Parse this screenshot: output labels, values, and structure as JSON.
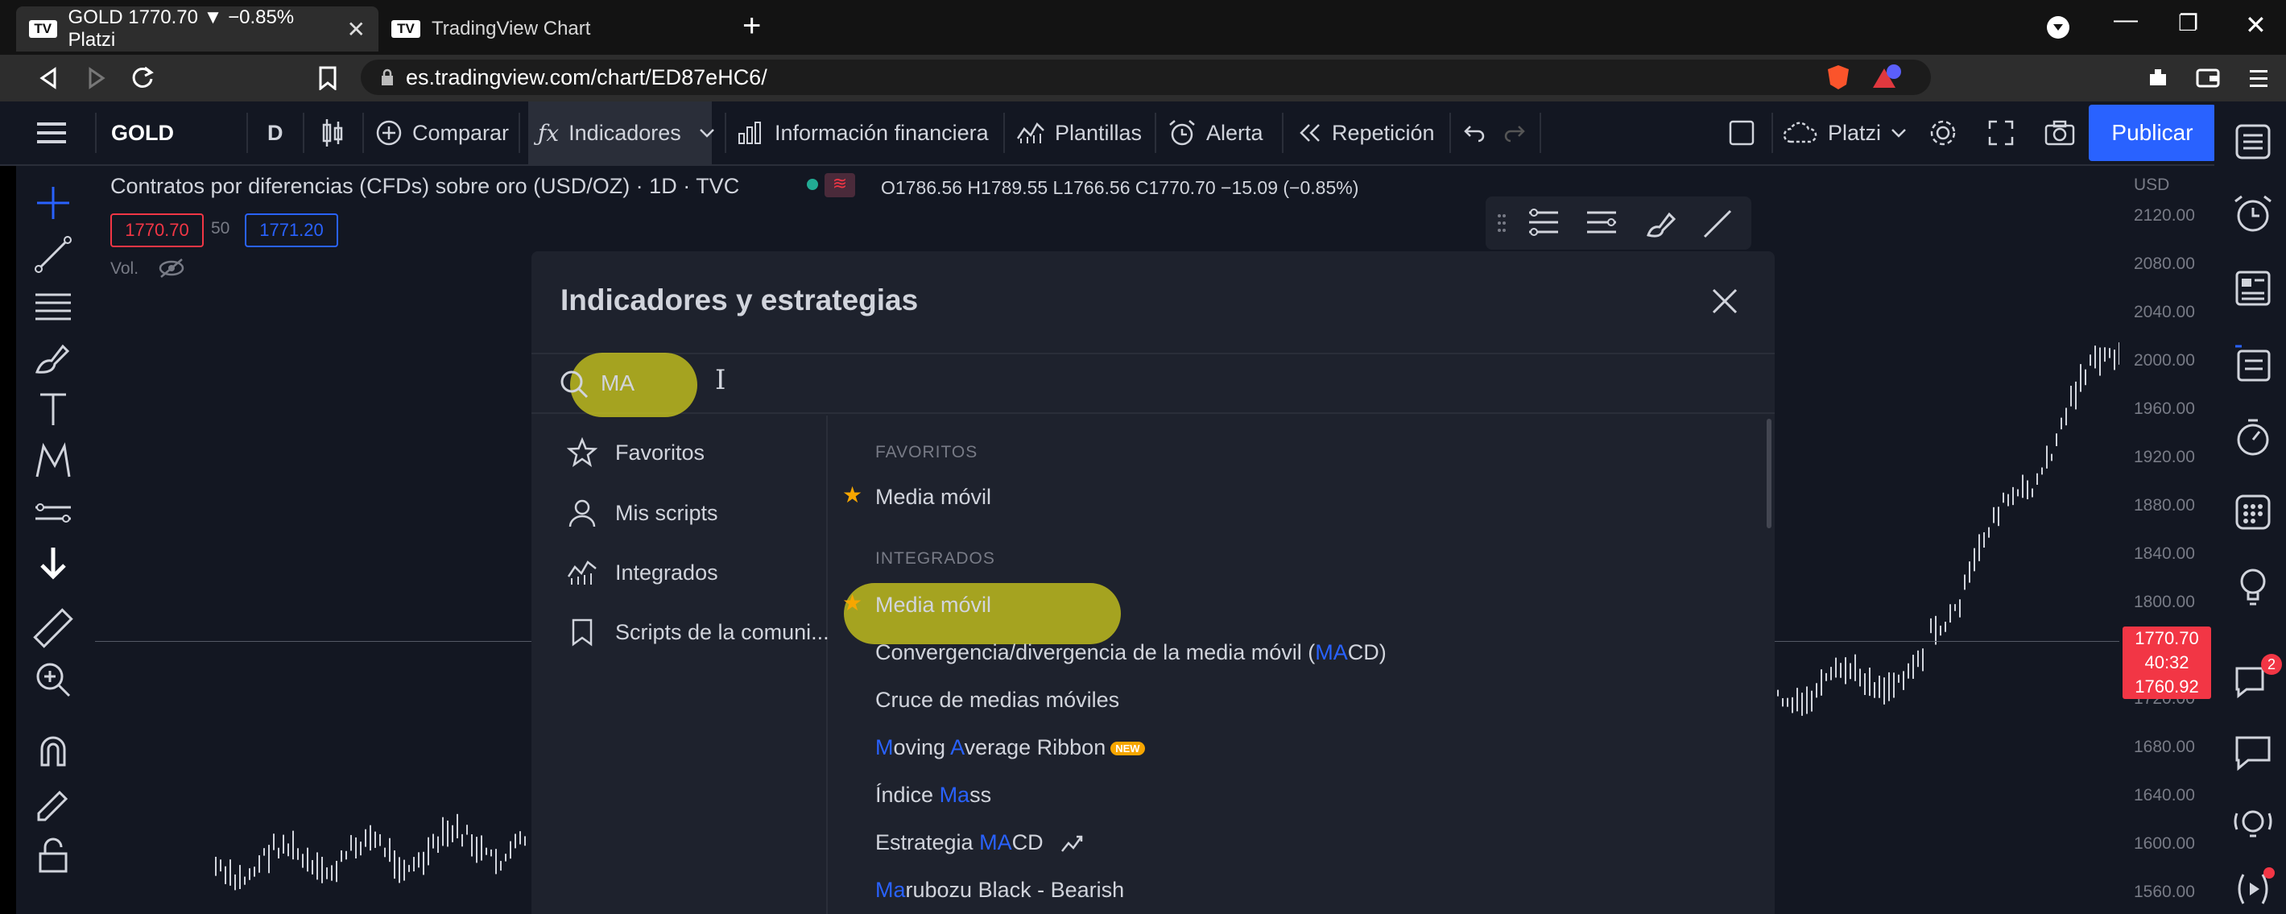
{
  "browser": {
    "tabs": [
      {
        "title": "GOLD 1770.70 ▼ −0.85% Platzi",
        "close": "✕"
      },
      {
        "title": "TradingView Chart"
      }
    ],
    "new_tab": "+",
    "url": "es.tradingview.com/chart/ED87eHC6/",
    "window_controls": {
      "minimize": "—",
      "maximize": "❐",
      "close": "✕"
    }
  },
  "toolbar": {
    "symbol": "GOLD",
    "interval": "D",
    "compare": "Comparar",
    "indicators": "Indicadores",
    "financials": "Información financiera",
    "templates": "Plantillas",
    "alert": "Alerta",
    "replay": "Repetición",
    "layout_name": "Platzi",
    "publish": "Publicar"
  },
  "legend": {
    "title": "Contratos por diferencias (CFDs) sobre oro (USD/OZ) · 1D · TVC",
    "ohlc": "O1786.56  H1789.55  L1766.56  C1770.70  −15.09 (−0.85%)",
    "bid": "1770.70",
    "spread": "50",
    "ask": "1771.20",
    "vol": "Vol."
  },
  "price_axis": {
    "currency": "USD",
    "labels": [
      "2120.00",
      "2080.00",
      "2040.00",
      "2000.00",
      "1960.00",
      "1920.00",
      "1880.00",
      "1840.00",
      "1800.00",
      "1720.00",
      "1680.00",
      "1640.00",
      "1600.00",
      "1560.00"
    ],
    "current": {
      "price": "1770.70",
      "countdown": "40:32",
      "low": "1760.92"
    }
  },
  "dialog": {
    "title": "Indicadores y estrategias",
    "search_value": "MA",
    "categories": [
      "Favoritos",
      "Mis scripts",
      "Integrados",
      "Scripts de la comuni..."
    ],
    "favorites_header": "FAVORITOS",
    "favorites": [
      "Media móvil"
    ],
    "builtin_header": "INTEGRADOS",
    "builtin": [
      {
        "pre": "",
        "hl": "",
        "post": "Media móvil"
      },
      {
        "pre": "Convergencia/divergencia de la media móvil (",
        "hl": "MA",
        "post": "CD)"
      },
      {
        "pre": "",
        "hl": "",
        "post": "Cruce de medias móviles"
      },
      {
        "pre": "",
        "hl": "M",
        "post": "oving ",
        "hl2": "A",
        "post2": "verage Ribbon",
        "badge": "NEW"
      },
      {
        "pre": "Índice ",
        "hl": "Ma",
        "post": "ss"
      },
      {
        "pre": "Estrategia ",
        "hl": "MA",
        "post": "CD"
      },
      {
        "pre": "",
        "hl": "Ma",
        "post": "rubozu Black - Bearish"
      }
    ]
  },
  "notifications_badge": "2",
  "colors": {
    "accent": "#2962ff",
    "bg": "#131722",
    "panel": "#1e222d",
    "star": "#f7a600",
    "bear": "#f23645",
    "marker": "#d8d61c"
  },
  "icons": [
    "menu-icon",
    "crosshair-icon",
    "trendline-icon",
    "fib-icon",
    "brush-icon",
    "text-icon",
    "pattern-icon",
    "measure-icon",
    "zoom-icon",
    "magnet-icon",
    "lock-icon",
    "watchlist-icon",
    "alarm-icon",
    "news-icon",
    "calendar-icon",
    "idea-icon",
    "chat-icon",
    "stream-icon"
  ]
}
